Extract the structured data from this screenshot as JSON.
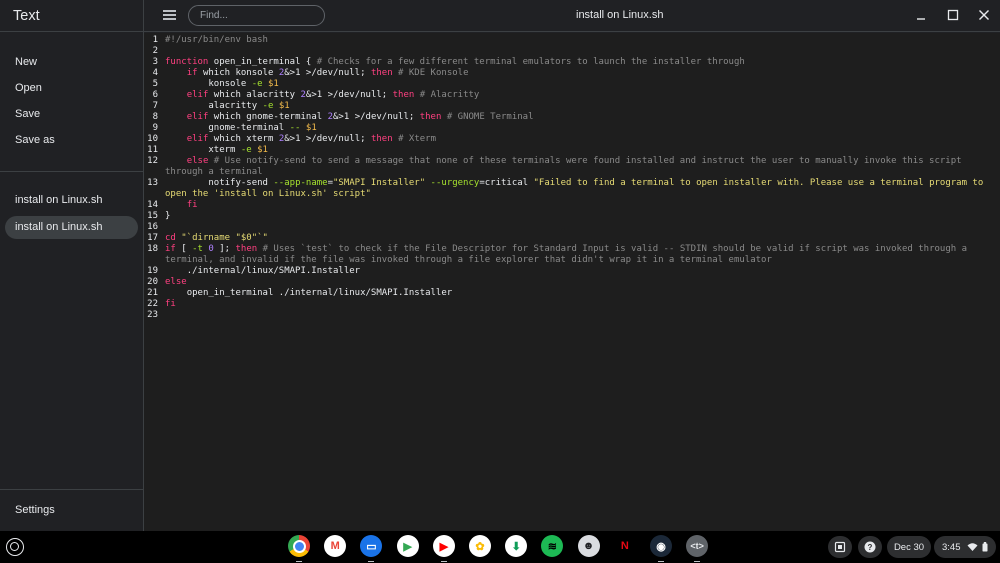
{
  "app": {
    "title": "Text"
  },
  "menu": {
    "new": "New",
    "open": "Open",
    "save": "Save",
    "save_as": "Save as"
  },
  "files": [
    "install on Linux.sh",
    "install on Linux.sh"
  ],
  "settings_label": "Settings",
  "toolbar": {
    "find_placeholder": "Find...",
    "document_title": "install on Linux.sh"
  },
  "editor": {
    "line_numbers": [
      "1",
      "2",
      "3",
      "4",
      "5",
      "6",
      "7",
      "8",
      "9",
      "10",
      "11",
      "12",
      "13",
      "14",
      "15",
      "16",
      "17",
      "18",
      "19",
      "20",
      "21",
      "22",
      "23"
    ],
    "lines": [
      [
        {
          "t": "#!/usr/bin/env bash",
          "c": "cm"
        }
      ],
      [],
      [
        {
          "t": "function",
          "c": "kw"
        },
        {
          "t": " open_in_terminal { "
        },
        {
          "t": "# Checks for a few different terminal emulators to launch the installer through",
          "c": "cm"
        }
      ],
      [
        {
          "t": "    "
        },
        {
          "t": "if",
          "c": "kw"
        },
        {
          "t": " which konsole "
        },
        {
          "t": "2",
          "c": "nm"
        },
        {
          "t": "&>1 >/dev/null; "
        },
        {
          "t": "then",
          "c": "kw"
        },
        {
          "t": " "
        },
        {
          "t": "# KDE Konsole",
          "c": "cm"
        }
      ],
      [
        {
          "t": "        konsole "
        },
        {
          "t": "-e",
          "c": "op"
        },
        {
          "t": " "
        },
        {
          "t": "$1",
          "c": "vr"
        }
      ],
      [
        {
          "t": "    "
        },
        {
          "t": "elif",
          "c": "kw"
        },
        {
          "t": " which alacritty "
        },
        {
          "t": "2",
          "c": "nm"
        },
        {
          "t": "&>1 >/dev/null; "
        },
        {
          "t": "then",
          "c": "kw"
        },
        {
          "t": " "
        },
        {
          "t": "# Alacritty",
          "c": "cm"
        }
      ],
      [
        {
          "t": "        alacritty "
        },
        {
          "t": "-e",
          "c": "op"
        },
        {
          "t": " "
        },
        {
          "t": "$1",
          "c": "vr"
        }
      ],
      [
        {
          "t": "    "
        },
        {
          "t": "elif",
          "c": "kw"
        },
        {
          "t": " which gnome-terminal "
        },
        {
          "t": "2",
          "c": "nm"
        },
        {
          "t": "&>1 >/dev/null; "
        },
        {
          "t": "then",
          "c": "kw"
        },
        {
          "t": " "
        },
        {
          "t": "# GNOME Terminal",
          "c": "cm"
        }
      ],
      [
        {
          "t": "        gnome-terminal "
        },
        {
          "t": "--",
          "c": "op"
        },
        {
          "t": " "
        },
        {
          "t": "$1",
          "c": "vr"
        }
      ],
      [
        {
          "t": "    "
        },
        {
          "t": "elif",
          "c": "kw"
        },
        {
          "t": " which xterm "
        },
        {
          "t": "2",
          "c": "nm"
        },
        {
          "t": "&>1 >/dev/null; "
        },
        {
          "t": "then",
          "c": "kw"
        },
        {
          "t": " "
        },
        {
          "t": "# Xterm",
          "c": "cm"
        }
      ],
      [
        {
          "t": "        xterm "
        },
        {
          "t": "-e",
          "c": "op"
        },
        {
          "t": " "
        },
        {
          "t": "$1",
          "c": "vr"
        }
      ],
      [
        {
          "t": "    "
        },
        {
          "t": "else",
          "c": "kw"
        },
        {
          "t": " "
        },
        {
          "t": "# Use notify-send to send a message that none of these terminals were found installed and instruct the user to manually invoke this script through a terminal",
          "c": "cm"
        }
      ],
      [
        {
          "t": "        notify-send "
        },
        {
          "t": "--app-name",
          "c": "op"
        },
        {
          "t": "="
        },
        {
          "t": "\"SMAPI Installer\"",
          "c": "st"
        },
        {
          "t": " "
        },
        {
          "t": "--urgency",
          "c": "op"
        },
        {
          "t": "=critical "
        },
        {
          "t": "\"Failed to find a terminal to open installer with. Please use a terminal program to open the 'install on Linux.sh' script\"",
          "c": "st"
        }
      ],
      [
        {
          "t": "    "
        },
        {
          "t": "fi",
          "c": "kw"
        }
      ],
      [
        {
          "t": "}"
        }
      ],
      [],
      [
        {
          "t": "cd",
          "c": "kw"
        },
        {
          "t": " "
        },
        {
          "t": "\"`dirname \"$0\"`\"",
          "c": "st"
        }
      ],
      [
        {
          "t": "if",
          "c": "kw"
        },
        {
          "t": " [ "
        },
        {
          "t": "-t",
          "c": "op"
        },
        {
          "t": " "
        },
        {
          "t": "0",
          "c": "nm"
        },
        {
          "t": " ]; "
        },
        {
          "t": "then",
          "c": "kw"
        },
        {
          "t": " "
        },
        {
          "t": "# Uses `test` to check if the File Descriptor for Standard Input is valid -- STDIN should be valid if script was invoked through a terminal, and invalid if the file was invoked through a file explorer that didn't wrap it in a terminal emulator",
          "c": "cm"
        }
      ],
      [
        {
          "t": "    ./internal/linux/SMAPI.Installer"
        }
      ],
      [
        {
          "t": "else",
          "c": "kw"
        }
      ],
      [
        {
          "t": "    open_in_terminal ./internal/linux/SMAPI.Installer"
        }
      ],
      [
        {
          "t": "fi",
          "c": "kw"
        }
      ],
      []
    ]
  },
  "shelf": {
    "apps": [
      {
        "name": "chrome-icon",
        "color": "#4285f4",
        "glyph": ""
      },
      {
        "name": "gmail-icon",
        "color": "#ffffff",
        "glyph": "M"
      },
      {
        "name": "files-icon",
        "color": "#1a73e8",
        "glyph": "▭"
      },
      {
        "name": "play-store-icon",
        "color": "#ffffff",
        "glyph": "▶"
      },
      {
        "name": "youtube-icon",
        "color": "#ffffff",
        "glyph": "▶"
      },
      {
        "name": "photos-icon",
        "color": "#ffffff",
        "glyph": "✿"
      },
      {
        "name": "sheets-download-icon",
        "color": "#ffffff",
        "glyph": "⬇"
      },
      {
        "name": "spotify-icon",
        "color": "#1db954",
        "glyph": "≋"
      },
      {
        "name": "linux-penguin-icon",
        "color": "#dadce0",
        "glyph": "☻"
      },
      {
        "name": "netflix-icon",
        "color": "#000000",
        "glyph": "N"
      },
      {
        "name": "steam-icon",
        "color": "#1b2838",
        "glyph": "◉"
      },
      {
        "name": "text-app-icon",
        "color": "#5f6368",
        "glyph": "<t>"
      }
    ],
    "date": "Dec 30",
    "time": "3:45"
  }
}
